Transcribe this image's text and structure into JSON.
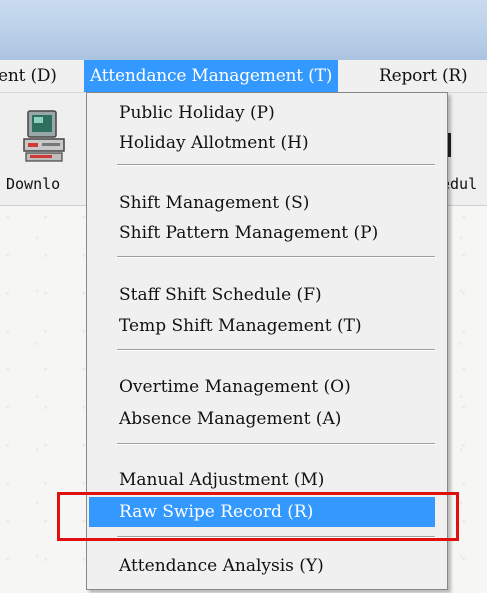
{
  "menubar": {
    "items": [
      {
        "label": "ent (D)"
      },
      {
        "label": "Attendance Management (T)"
      },
      {
        "label": "Report (R)"
      }
    ]
  },
  "toolbar": {
    "left_label": "Downlo",
    "right_label": "edul",
    "left_icon": "download-device-icon",
    "right_icon": "schedule-icon"
  },
  "dropdown": {
    "items": [
      {
        "label": "Public Holiday (P)"
      },
      {
        "label": "Holiday Allotment (H)"
      },
      {
        "label": "Shift Management (S)"
      },
      {
        "label": "Shift Pattern Management (P)"
      },
      {
        "label": "Staff Shift Schedule (F)"
      },
      {
        "label": "Temp Shift Management (T)"
      },
      {
        "label": "Overtime Management (O)"
      },
      {
        "label": "Absence Management (A)"
      },
      {
        "label": "Manual Adjustment (M)"
      },
      {
        "label": "Raw Swipe Record (R)"
      },
      {
        "label": "Attendance Analysis (Y)"
      }
    ],
    "highlighted_item": "Raw Swipe Record (R)"
  },
  "colors": {
    "highlight": "#3399ff",
    "annotation_box": "#e01010"
  }
}
